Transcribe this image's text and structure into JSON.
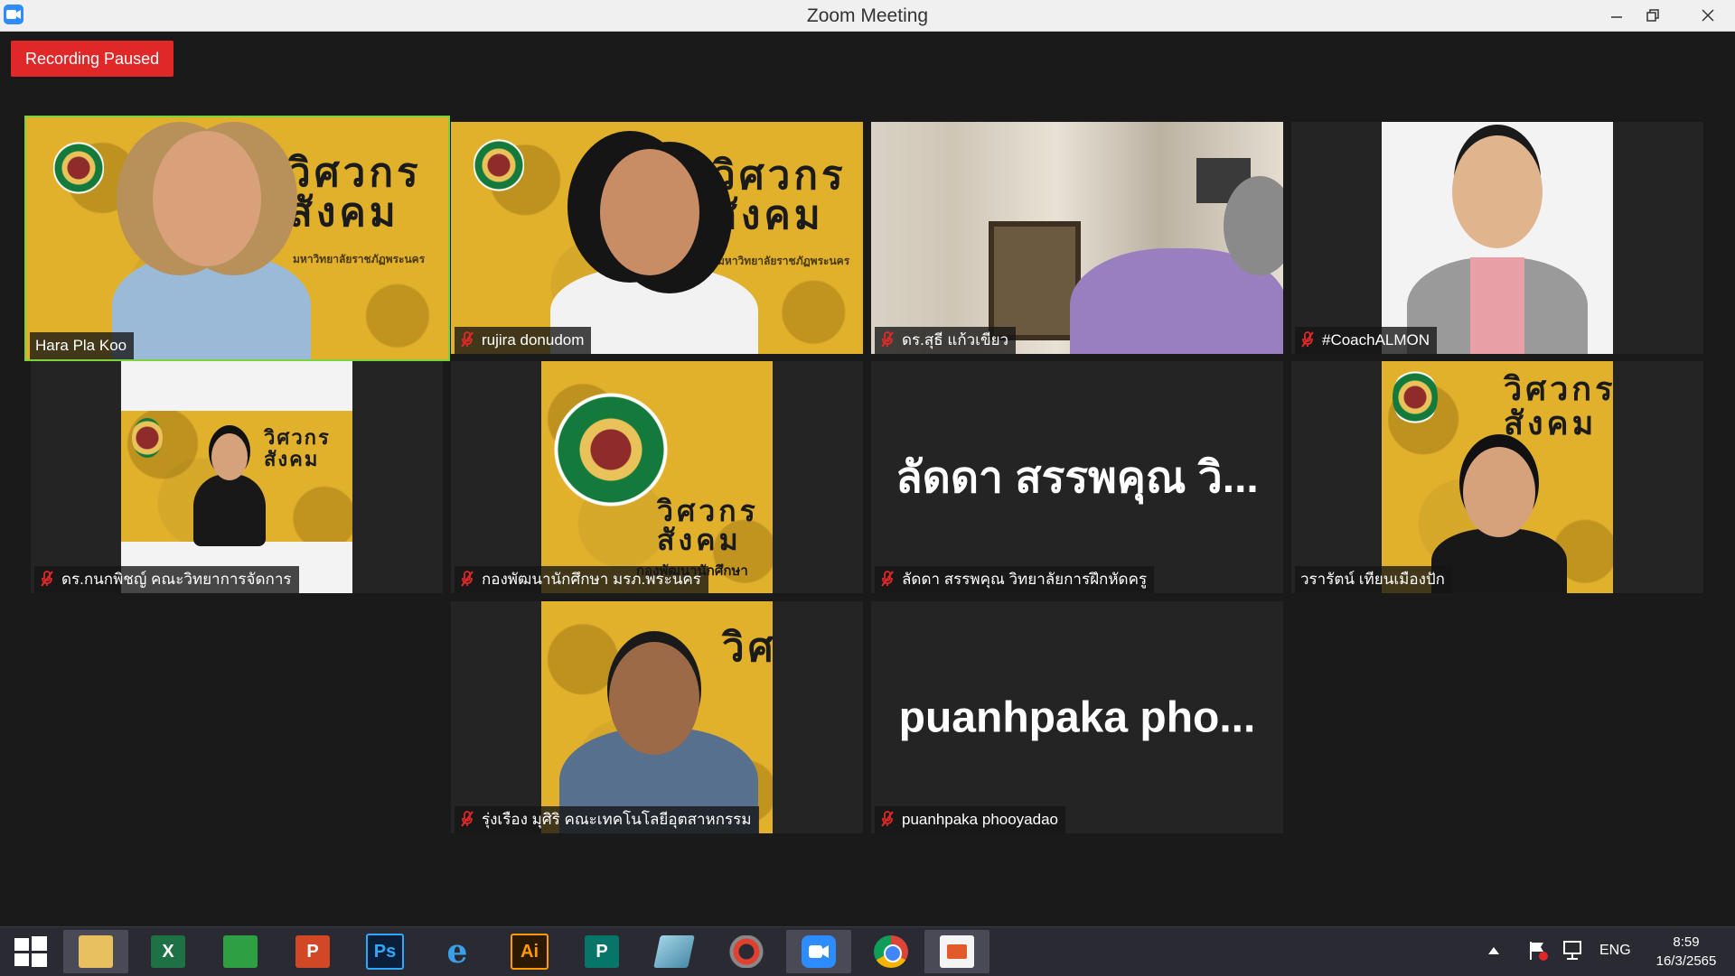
{
  "window": {
    "title": "Zoom Meeting",
    "controls": [
      "minimize",
      "restore",
      "close"
    ]
  },
  "recording": {
    "status_label": "Recording Paused",
    "color": "#e02828"
  },
  "participants": [
    {
      "name": "Hara Pla Koo",
      "muted": false,
      "active_speaker": true,
      "video": "camera"
    },
    {
      "name": "rujira donudom",
      "muted": true,
      "active_speaker": false,
      "video": "camera"
    },
    {
      "name": "ดร.สุธี  แก้วเขียว",
      "muted": true,
      "active_speaker": false,
      "video": "camera"
    },
    {
      "name": "#CoachALMON",
      "muted": true,
      "active_speaker": false,
      "video": "camera"
    },
    {
      "name": "ดร.กนกพิชญ์ คณะวิทยาการจัดการ",
      "muted": true,
      "active_speaker": false,
      "video": "camera"
    },
    {
      "name": "กองพัฒนานักศึกษา มรภ.พระนคร",
      "muted": true,
      "active_speaker": false,
      "video": "camera"
    },
    {
      "name": "ลัดดา สรรพคุณ วิทยาลัยการฝึกหัดครู",
      "muted": true,
      "active_speaker": false,
      "video": "off",
      "display_name": "ลัดดา สรรพคุณ วิ..."
    },
    {
      "name": "วรารัตน์ เทียนเมืองปัก",
      "muted": false,
      "active_speaker": false,
      "video": "camera"
    },
    {
      "name": "รุ่งเรือง มุศิริ คณะเทคโนโลยีอุตสาหกรรม",
      "muted": true,
      "active_speaker": false,
      "video": "camera"
    },
    {
      "name": "puanhpaka phooyadao",
      "muted": true,
      "active_speaker": false,
      "video": "off",
      "display_name": "puanhpaka  pho..."
    }
  ],
  "banner": {
    "title_line1": "วิศวกร",
    "title_line2": "สังคม",
    "subtitle": "มหาวิทยาลัยราชภัฏพระนคร",
    "unit_caption": "กองพัฒนานักศึกษา"
  },
  "taskbar": {
    "apps": [
      {
        "name": "start-icon",
        "label": ""
      },
      {
        "name": "file-explorer-icon",
        "label": ""
      },
      {
        "name": "excel-icon",
        "label": "X"
      },
      {
        "name": "store-icon",
        "label": ""
      },
      {
        "name": "powerpoint-icon",
        "label": "P"
      },
      {
        "name": "photoshop-icon",
        "label": "Ps"
      },
      {
        "name": "internet-explorer-icon",
        "label": "e"
      },
      {
        "name": "illustrator-icon",
        "label": "Ai"
      },
      {
        "name": "publisher-icon",
        "label": "P"
      },
      {
        "name": "notes-icon",
        "label": ""
      },
      {
        "name": "photoscape-icon",
        "label": ""
      },
      {
        "name": "zoom-icon",
        "label": ""
      },
      {
        "name": "chrome-icon",
        "label": ""
      },
      {
        "name": "photo-app-icon",
        "label": ""
      }
    ],
    "language": "ENG",
    "time": "8:59",
    "date": "16/3/2565"
  },
  "colors": {
    "active_speaker_border": "#7ad33a",
    "banner_yellow": "#e2b12c",
    "tile_background": "#242424"
  }
}
